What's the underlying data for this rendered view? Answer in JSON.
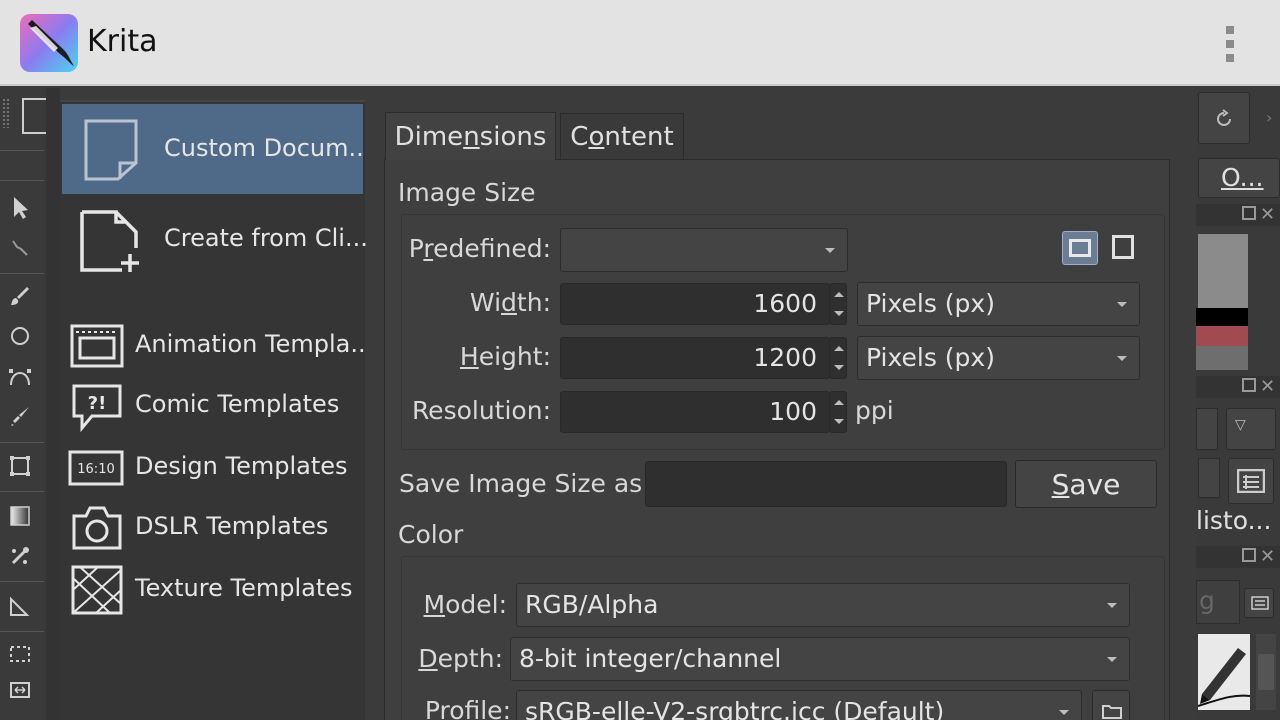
{
  "app": {
    "title": "Krita"
  },
  "templates": {
    "items": [
      {
        "label": "Custom Docum...",
        "icon": "blank-document-icon",
        "selected": true
      },
      {
        "label": "Create from Cli...",
        "icon": "document-add-icon"
      },
      {
        "label": "Animation Templa...",
        "icon": "film-frame-icon"
      },
      {
        "label": "Comic Templates",
        "icon": "speech-bubble-icon",
        "icon_text": "?!"
      },
      {
        "label": "Design Templates",
        "icon": "aspect-ratio-icon",
        "icon_text": "16:10"
      },
      {
        "label": "DSLR Templates",
        "icon": "camera-icon"
      },
      {
        "label": "Texture Templates",
        "icon": "texture-icon"
      }
    ]
  },
  "tabs": [
    {
      "pre": "Dime",
      "key": "n",
      "post": "sions",
      "active": true
    },
    {
      "pre": "C",
      "key": "o",
      "post": "ntent",
      "active": false
    }
  ],
  "image_size": {
    "title": "Image Size",
    "predefined": {
      "pre": "P",
      "key": "r",
      "post": "edefined:",
      "value": ""
    },
    "width": {
      "pre": "Wi",
      "key": "d",
      "post": "th:",
      "value": "1600",
      "unit": "Pixels (px)"
    },
    "height": {
      "pre": "",
      "key": "H",
      "post": "eight:",
      "value": "1200",
      "unit": "Pixels (px)"
    },
    "resolution": {
      "label": "Resolution:",
      "value": "100",
      "unit": "ppi"
    },
    "orientation": {
      "landscape_icon": "landscape-icon",
      "portrait_icon": "portrait-icon",
      "active": "landscape"
    }
  },
  "save_size": {
    "label": "Save Image Size as:",
    "value": "",
    "button_key": "S",
    "button_post": "ave"
  },
  "color": {
    "title": "Color",
    "model": {
      "pre": "",
      "key": "M",
      "post": "odel:",
      "value": "RGB/Alpha"
    },
    "depth": {
      "pre": "",
      "key": "D",
      "post": "epth:",
      "value": "8-bit integer/channel"
    },
    "profile": {
      "pre": "",
      "key": "P",
      "post": "rofile:",
      "value": "sRGB-elle-V2-srgbtrc.icc (Default)"
    }
  },
  "right_dock": {
    "tab_label": "O...",
    "history_label": "listo...",
    "search_placeholder": "g"
  },
  "colors": {
    "selection": "#4f6a88",
    "appbar": "#e3e3e3",
    "background": "#3b3b3b"
  }
}
